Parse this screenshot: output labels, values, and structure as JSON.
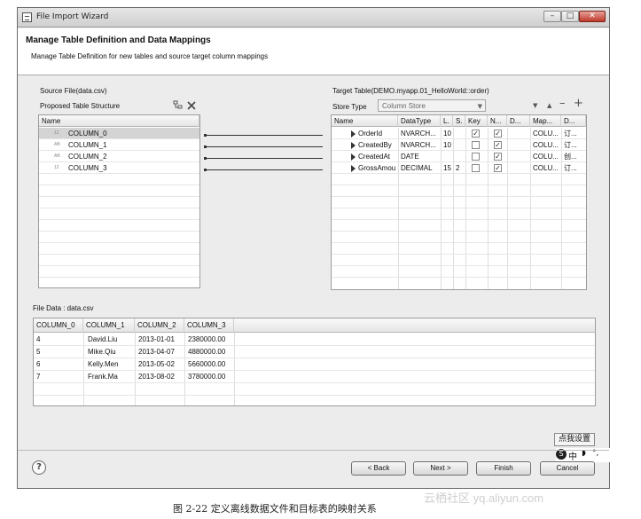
{
  "window": {
    "title": "File Import Wizard",
    "minimize": "–",
    "maximize": "□",
    "close": "✕"
  },
  "header": {
    "title": "Manage Table Definition and Data Mappings",
    "subtitle": "Manage Table Definition for new tables and source target column mappings"
  },
  "source": {
    "group_label": "Source File(data.csv)",
    "structure_label": "Proposed Table Structure",
    "col_header": "Name",
    "rows": [
      {
        "type": "12",
        "name": "COLUMN_0"
      },
      {
        "type": "AB",
        "name": "COLUMN_1"
      },
      {
        "type": "AB",
        "name": "COLUMN_2"
      },
      {
        "type": "12",
        "name": "COLUMN_3"
      }
    ]
  },
  "target": {
    "group_label": "Target Table(DEMO.myapp.01_HelloWorld::order)",
    "store_type_label": "Store Type",
    "store_type_value": "Column Store",
    "headers": [
      "Name",
      "DataType",
      "L.",
      "S.",
      "Key",
      "N...",
      "D...",
      "Map...",
      "D..."
    ],
    "rows": [
      {
        "name": "OrderId",
        "type": "NVARCH...",
        "len": "10",
        "scale": "",
        "key": true,
        "nullable": true,
        "default": "",
        "map": "COLU...",
        "desc": "订..."
      },
      {
        "name": "CreatedBy",
        "type": "NVARCH...",
        "len": "10",
        "scale": "",
        "key": false,
        "nullable": true,
        "default": "",
        "map": "COLU...",
        "desc": "订..."
      },
      {
        "name": "CreatedAt",
        "type": "DATE",
        "len": "",
        "scale": "",
        "key": false,
        "nullable": true,
        "default": "",
        "map": "COLU...",
        "desc": "创..."
      },
      {
        "name": "GrossAmou",
        "type": "DECIMAL",
        "len": "15",
        "scale": "2",
        "key": false,
        "nullable": true,
        "default": "",
        "map": "COLU...",
        "desc": "订..."
      }
    ]
  },
  "file_data": {
    "label": "File Data : data.csv",
    "headers": [
      "COLUMN_0",
      "COLUMN_1",
      "COLUMN_2",
      "COLUMN_3"
    ],
    "rows": [
      [
        "4",
        "David.Liu",
        "2013-01-01",
        "2380000.00"
      ],
      [
        "5",
        "Mike.Qiu",
        "2013-04-07",
        "4880000.00"
      ],
      [
        "6",
        "Kelly.Men",
        "2013-05-02",
        "5660000.00"
      ],
      [
        "7",
        "Frank.Ma",
        "2013-08-02",
        "3780000.00"
      ]
    ]
  },
  "ime": {
    "settings": "点我设置",
    "lang": "中"
  },
  "footer": {
    "help": "?",
    "back": "< Back",
    "next": "Next >",
    "finish": "Finish",
    "cancel": "Cancel"
  },
  "caption": "图 2-22   定义离线数据文件和目标表的映射关系",
  "watermark": "云栖社区 yq.aliyun.com"
}
